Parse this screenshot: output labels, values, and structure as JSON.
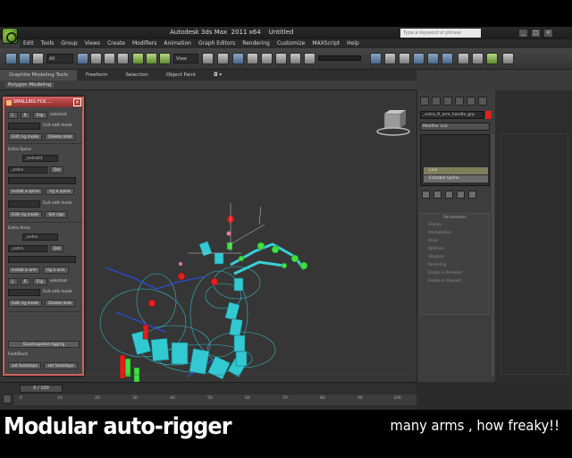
{
  "window": {
    "title": "Autodesk 3ds Max  2011 x64    Untitled",
    "search_placeholder": "Type a keyword or phrase",
    "controls": [
      "_",
      "□",
      "×"
    ]
  },
  "menubar": [
    "Edit",
    "Tools",
    "Group",
    "Views",
    "Create",
    "Modifiers",
    "Animation",
    "Graph Editors",
    "Rendering",
    "Customize",
    "MAXScript",
    "Help"
  ],
  "toolbar": {
    "selection_filter": "All",
    "reference_coord": "View"
  },
  "ribbon": {
    "tabs": [
      "Graphite Modeling Tools",
      "Freeform",
      "Selection",
      "Object Paint",
      "◘ ▾"
    ],
    "active_panel": "Polygon Modeling"
  },
  "rig_panel": {
    "title": "SMALLRIG FCK ...",
    "rows": {
      "top_buttons": [
        "L",
        "R",
        "Flip"
      ],
      "top_check": "selected",
      "edit_mode_1": "Exit edit mode",
      "edit_rig_mode_1": "Edit rig mode",
      "delete_limb_1": "Delete limb",
      "extra_spine_label": "Extra Spine",
      "spine_field": "_extra01",
      "spine_select": "_extra",
      "install_spine": "install a spine",
      "rig_spine": "rig a spine",
      "edit_mode_2": "Exit edit mode",
      "edit_rig_mode_2": "Edit rig mode",
      "set_rigs": "Set rigs",
      "extra_arms_label": "Extra Arms",
      "arm_field": "_extra",
      "arm_select": "_extra",
      "install_arm": "install a arm",
      "rig_arm": "rig a arm",
      "selected_2": "selected",
      "edit_mode_3": "Exit edit mode",
      "edit_rig_mode_3": "Edit rig mode",
      "delete_limb_3": "Delete limb",
      "quadrupedal": "Quadrupedal rigging",
      "feet_label": "Feet/Back",
      "set_footsteps": "set footsteps",
      "set_footsteps_2": "set footsteps"
    }
  },
  "command_panel": {
    "object_name": "_extra_R_arm_handle_grp",
    "object_color": "#e02020",
    "modifier_list": "Modifier List",
    "stack": [
      "Line",
      "Editable Spline"
    ],
    "parameters_header": "Parameters",
    "param_lines": [
      "Display",
      "Interpolation",
      "Steps",
      "Optimize",
      "Adaptive",
      "Rendering",
      "Enable In Renderer",
      "Enable In Viewport"
    ]
  },
  "timeline": {
    "frame": "0 / 100",
    "ticks": [
      "0",
      "10",
      "20",
      "30",
      "40",
      "50",
      "60",
      "70",
      "80",
      "90",
      "100"
    ]
  },
  "caption": {
    "left": "Modular auto-rigger",
    "right": "many arms , how freaky!!"
  },
  "colors": {
    "viewport_bg": "#363636",
    "panel_accent": "#d06060",
    "rig_cyan": "#3ad0d8",
    "rig_red": "#e02020",
    "rig_green": "#40e040",
    "rig_blue": "#2a4bd0"
  }
}
